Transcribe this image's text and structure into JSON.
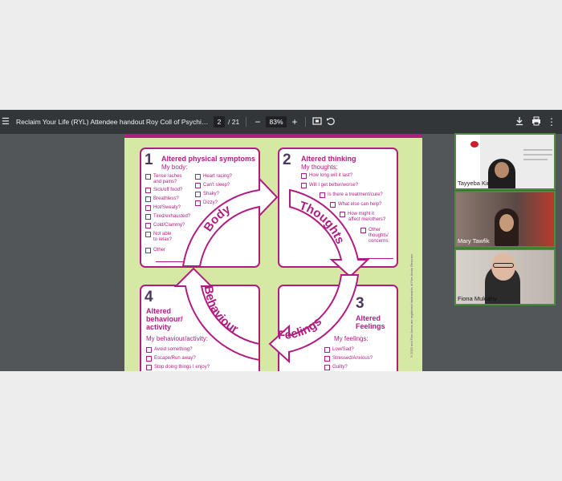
{
  "viewer": {
    "title": "Reclaim Your Life (RYL) Attendee handout Roy Coll of Psychiatris...",
    "page_current": "2",
    "page_total": "/ 21",
    "zoom": "83%",
    "menu_icon": "menu-icon",
    "download_icon": "download-icon",
    "print_icon": "print-icon",
    "more_icon": "more-vert-icon"
  },
  "handout": {
    "box1": {
      "num": "1",
      "title": "Altered physical symptoms",
      "subtitle": "My body:",
      "col1": [
        "Tense /aches",
        "and pains?",
        "Sick/off food?",
        "Breathless?",
        "Hot/Sweaty?",
        "Tired/exhausted?",
        "Cold/Clammy?",
        "Not able",
        "to relax?",
        "Other"
      ],
      "col2": [
        "Heart racing?",
        "Can't sleep?",
        "Shaky?",
        "Dizzy?"
      ]
    },
    "box2": {
      "num": "2",
      "title": "Altered thinking",
      "subtitle": "My thoughts:",
      "items": [
        "How long will it last?",
        "Will I get better/worse?",
        "Is there a treatment/cure?",
        "What else can help?",
        "How might it",
        "affect me/others?",
        "Other",
        "thoughts/",
        "concerns:"
      ]
    },
    "box3": {
      "num": "3",
      "title1": "Altered",
      "title2": "Feelings",
      "subtitle": "My feelings:",
      "items": [
        "Low/Sad?",
        "Stressed/Anxious?",
        "Guilty?"
      ]
    },
    "box4": {
      "num": "4",
      "title1": "Altered",
      "title2": "behaviour/",
      "title3": "activity",
      "subtitle": "My behaviour/activity:",
      "items": [
        "Avoid something?",
        "Escape/Run away?",
        "Stop doing things I enjoy?"
      ]
    },
    "arrows": {
      "body": "Body",
      "thoughts": "Thoughts",
      "feelings": "Feelings",
      "behaviour": "Behaviour"
    },
    "side_note": "©2020 and Five Areas are registered trademarks of Five Areas Resources Ltd 12867",
    "colors": {
      "magenta": "#b01c81",
      "green": "#d5e8a4",
      "number": "#4d3960"
    }
  },
  "participants": [
    {
      "name": "Tayyeba Kiran",
      "bg": "#e9e9e9"
    },
    {
      "name": "Mary Tawfik",
      "bg": "#7a6a66"
    },
    {
      "name": "Fiona Mulcahy",
      "bg": "#c9c2bb"
    }
  ]
}
